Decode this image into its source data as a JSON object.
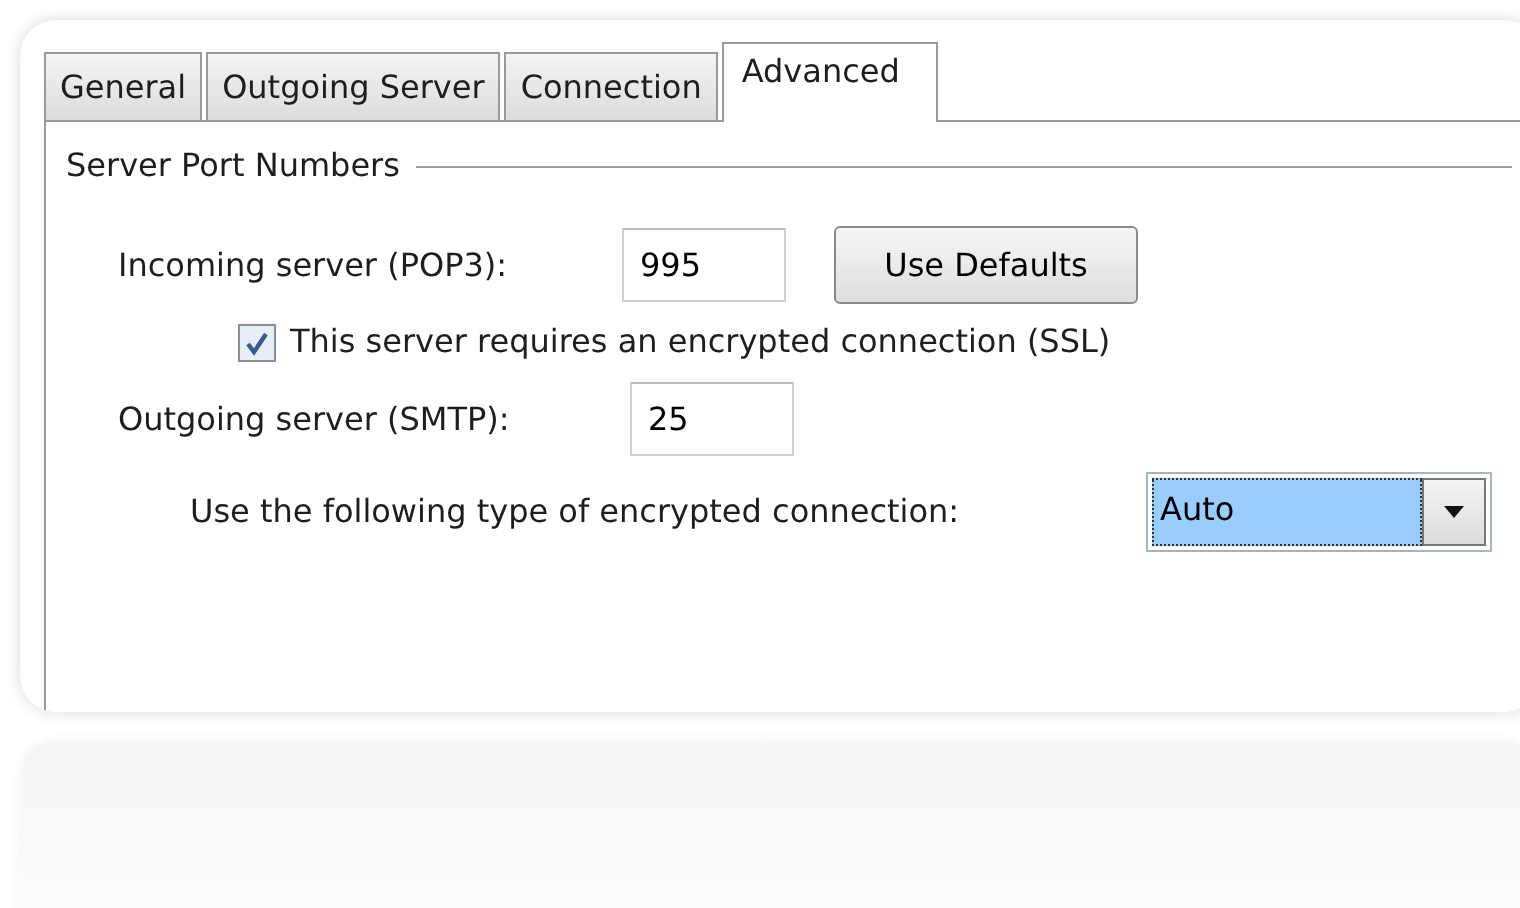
{
  "tabs": [
    {
      "label": "General",
      "selected": false
    },
    {
      "label": "Outgoing Server",
      "selected": false
    },
    {
      "label": "Connection",
      "selected": false
    },
    {
      "label": "Advanced",
      "selected": true
    }
  ],
  "group": {
    "title": "Server Port Numbers"
  },
  "incoming": {
    "label": "Incoming server (POP3):",
    "value": "995",
    "button": "Use Defaults"
  },
  "ssl": {
    "label": "This server requires an encrypted connection (SSL)",
    "checked": true
  },
  "outgoing": {
    "label": "Outgoing server (SMTP):",
    "value": "25"
  },
  "encryption": {
    "label": "Use the following type of encrypted connection:",
    "value": "Auto"
  }
}
